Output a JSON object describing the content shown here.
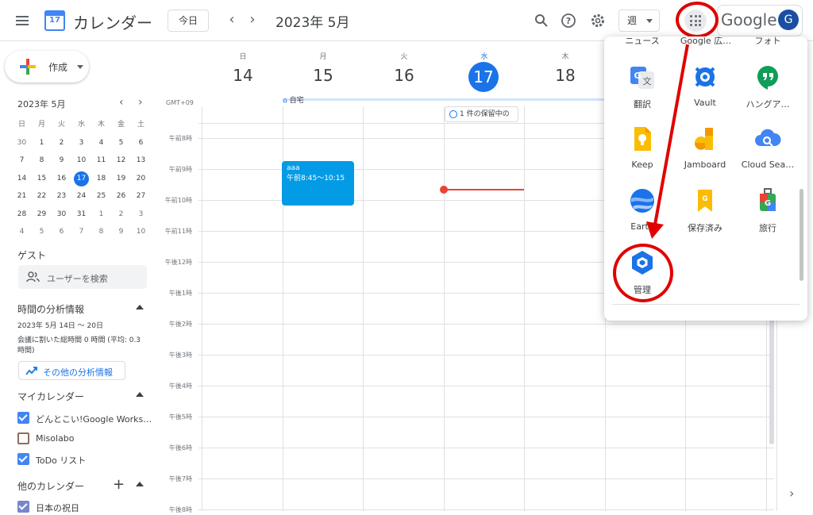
{
  "header": {
    "app_name": "カレンダー",
    "logo_day": "17",
    "today_button": "今日",
    "current_period": "2023年 5月",
    "view_label": "週",
    "google_wordmark": "Google",
    "avatar_letter": "G"
  },
  "sidebar": {
    "create_label": "作成",
    "mini_calendar": {
      "title": "2023年 5月",
      "weekdays": [
        "日",
        "月",
        "火",
        "水",
        "木",
        "金",
        "土"
      ],
      "weeks": [
        [
          "30",
          "1",
          "2",
          "3",
          "4",
          "5",
          "6"
        ],
        [
          "7",
          "8",
          "9",
          "10",
          "11",
          "12",
          "13"
        ],
        [
          "14",
          "15",
          "16",
          "17",
          "18",
          "19",
          "20"
        ],
        [
          "21",
          "22",
          "23",
          "24",
          "25",
          "26",
          "27"
        ],
        [
          "28",
          "29",
          "30",
          "31",
          "1",
          "2",
          "3"
        ],
        [
          "4",
          "5",
          "6",
          "7",
          "8",
          "9",
          "10"
        ]
      ],
      "today": "17"
    },
    "guests_heading": "ゲスト",
    "guest_search_placeholder": "ユーザーを検索",
    "analytics_heading": "時間の分析情報",
    "analytics_range": "2023年 5月 14日 〜 20日",
    "analytics_summary": "会議に割いた総時間 0 時間 (平均: 0.3 時間)",
    "analytics_button": "その他の分析情報",
    "my_calendars_heading": "マイカレンダー",
    "my_calendars": [
      {
        "name": "どんとこい!Google Works…",
        "checked": true
      },
      {
        "name": "Misolabo",
        "checked": false
      },
      {
        "name": "ToDo リスト",
        "checked": true
      }
    ],
    "other_calendars_heading": "他のカレンダー",
    "other_calendars": [
      {
        "name": "日本の祝日",
        "checked": true
      }
    ]
  },
  "week": {
    "timezone": "GMT+09",
    "days": [
      {
        "dow": "日",
        "num": "14"
      },
      {
        "dow": "月",
        "num": "15"
      },
      {
        "dow": "火",
        "num": "16"
      },
      {
        "dow": "水",
        "num": "17",
        "today": true
      },
      {
        "dow": "木",
        "num": "18"
      }
    ],
    "working_location": "自宅",
    "pending_chip": "1 件の保留中の",
    "time_labels": [
      "午前8時",
      "午前9時",
      "午前10時",
      "午前11時",
      "午後12時",
      "午後1時",
      "午後2時",
      "午後3時",
      "午後4時",
      "午後5時",
      "午後6時",
      "午後7時",
      "午後8時"
    ],
    "event": {
      "title": "aaa",
      "time": "午前8:45〜10:15"
    }
  },
  "apps_menu": {
    "cut_top_labels": [
      "ニュース",
      "Google 広…",
      "フォト"
    ],
    "apps": [
      {
        "label": "翻訳",
        "icon": "translate-icon"
      },
      {
        "label": "Vault",
        "icon": "vault-icon"
      },
      {
        "label": "ハングア…",
        "icon": "hangouts-icon"
      },
      {
        "label": "Keep",
        "icon": "keep-icon"
      },
      {
        "label": "Jamboard",
        "icon": "jamboard-icon"
      },
      {
        "label": "Cloud Sea…",
        "icon": "cloud-search-icon"
      },
      {
        "label": "Earth",
        "icon": "earth-icon"
      },
      {
        "label": "保存済み",
        "icon": "saved-icon"
      },
      {
        "label": "旅行",
        "icon": "travel-icon"
      },
      {
        "label": "管理",
        "icon": "admin-icon"
      }
    ]
  },
  "colors": {
    "accent": "#1a73e8",
    "event": "#039be5",
    "annotation_red": "#e00000",
    "now_line": "#ea4335"
  }
}
